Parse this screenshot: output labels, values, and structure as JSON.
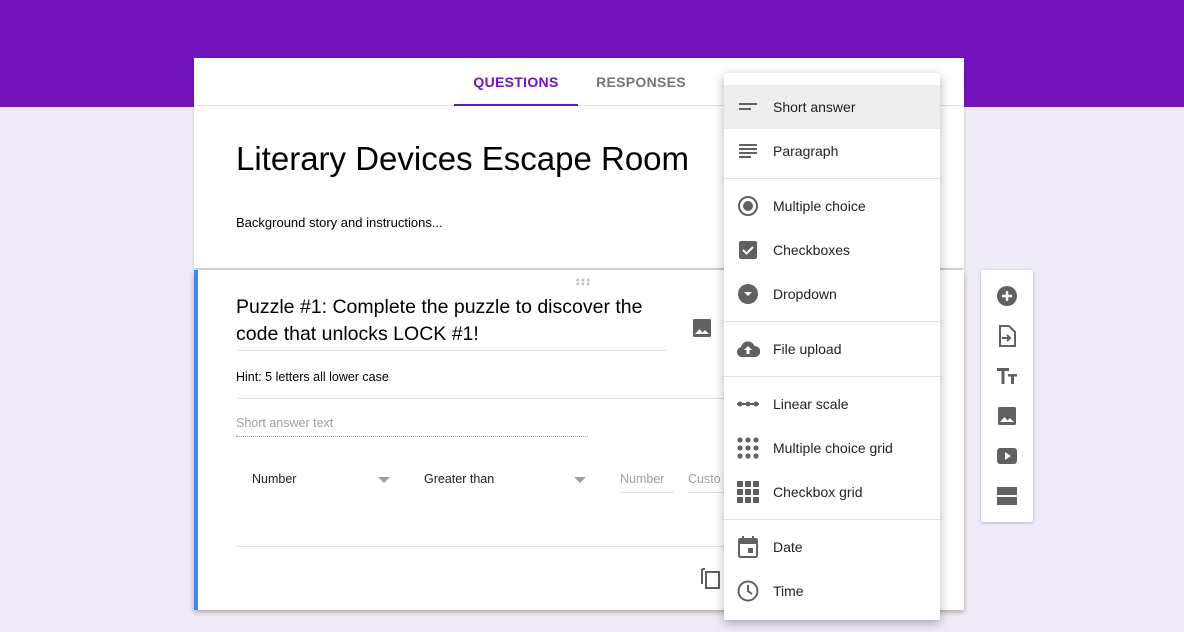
{
  "tabs": [
    {
      "label": "QUESTIONS",
      "active": true
    },
    {
      "label": "RESPONSES",
      "active": false
    }
  ],
  "form": {
    "title": "Literary Devices Escape Room",
    "description": "Background story and instructions..."
  },
  "question": {
    "title": "Puzzle #1:  Complete the puzzle to discover the code that unlocks LOCK #1!",
    "description": "Hint:  5 letters all lower case",
    "answer_placeholder": "Short answer text",
    "validation": {
      "type": "Number",
      "condition": "Greater than",
      "number_placeholder": "Number",
      "custom_placeholder": "Custo"
    }
  },
  "menu": {
    "items": [
      {
        "label": "Short answer",
        "icon": "short-text-icon",
        "selected": true
      },
      {
        "label": "Paragraph",
        "icon": "paragraph-icon"
      },
      {
        "label": "Multiple choice",
        "icon": "radio-button-icon"
      },
      {
        "label": "Checkboxes",
        "icon": "checkbox-icon"
      },
      {
        "label": "Dropdown",
        "icon": "dropdown-circle-icon"
      },
      {
        "label": "File upload",
        "icon": "cloud-upload-icon"
      },
      {
        "label": "Linear scale",
        "icon": "linear-scale-icon"
      },
      {
        "label": "Multiple choice grid",
        "icon": "dot-grid-icon"
      },
      {
        "label": "Checkbox grid",
        "icon": "square-grid-icon"
      },
      {
        "label": "Date",
        "icon": "calendar-icon"
      },
      {
        "label": "Time",
        "icon": "clock-icon"
      }
    ]
  },
  "toolbar": [
    "add-question-icon",
    "import-questions-icon",
    "add-title-icon",
    "add-image-icon",
    "add-video-icon",
    "add-section-icon"
  ],
  "colors": {
    "brand": "#7213bb",
    "accent_border": "#4285f4",
    "background": "#f0ebf8",
    "icon": "#616161"
  }
}
